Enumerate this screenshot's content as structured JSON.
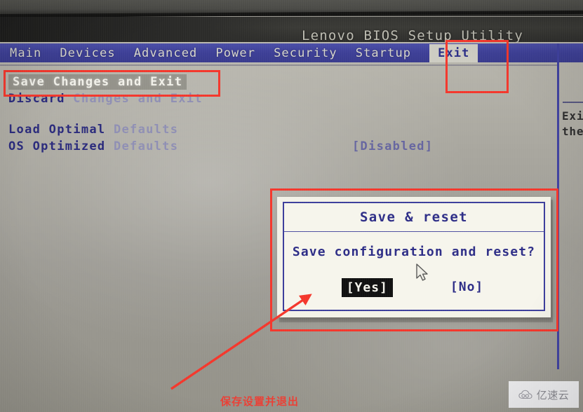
{
  "window": {
    "title": "Lenovo BIOS Setup Utility"
  },
  "menubar": {
    "items": [
      {
        "label": "Main",
        "selected": false
      },
      {
        "label": "Devices",
        "selected": false
      },
      {
        "label": "Advanced",
        "selected": false
      },
      {
        "label": "Power",
        "selected": false
      },
      {
        "label": "Security",
        "selected": false
      },
      {
        "label": "Startup",
        "selected": false
      },
      {
        "label": "Exit",
        "selected": true
      }
    ]
  },
  "exit_menu": {
    "items": [
      {
        "label": "Save Changes and Exit",
        "selected": true,
        "value": ""
      },
      {
        "label": "Discard Changes and Exit",
        "selected": false,
        "value": ""
      },
      {
        "label": "Load Optimal Defaults",
        "selected": false,
        "value": ""
      },
      {
        "label": "OS Optimized Defaults",
        "selected": false,
        "value": "[Disabled]"
      }
    ],
    "os_optimized_value": "[Disabled]"
  },
  "help_pane": {
    "line1": "Exi",
    "line2": "the"
  },
  "dialog": {
    "title": "Save & reset",
    "message": "Save configuration and reset?",
    "buttons": [
      {
        "label": "[Yes]",
        "focused": true
      },
      {
        "label": "[No]",
        "focused": false
      }
    ]
  },
  "annotations": {
    "accent_color": "#f4372c",
    "caption": "保存设置并退出",
    "boxes": [
      {
        "name": "save-changes-and-exit"
      },
      {
        "name": "exit-tab"
      },
      {
        "name": "save-and-reset-dialog"
      }
    ]
  },
  "watermark": {
    "text": "亿速云",
    "icon": "cloud-icon"
  },
  "colors": {
    "menubar_blue": "#3d3f96",
    "text_blue": "#2e2e87",
    "screen_grey": "#a8a69e",
    "annotation_red": "#f4372c"
  }
}
